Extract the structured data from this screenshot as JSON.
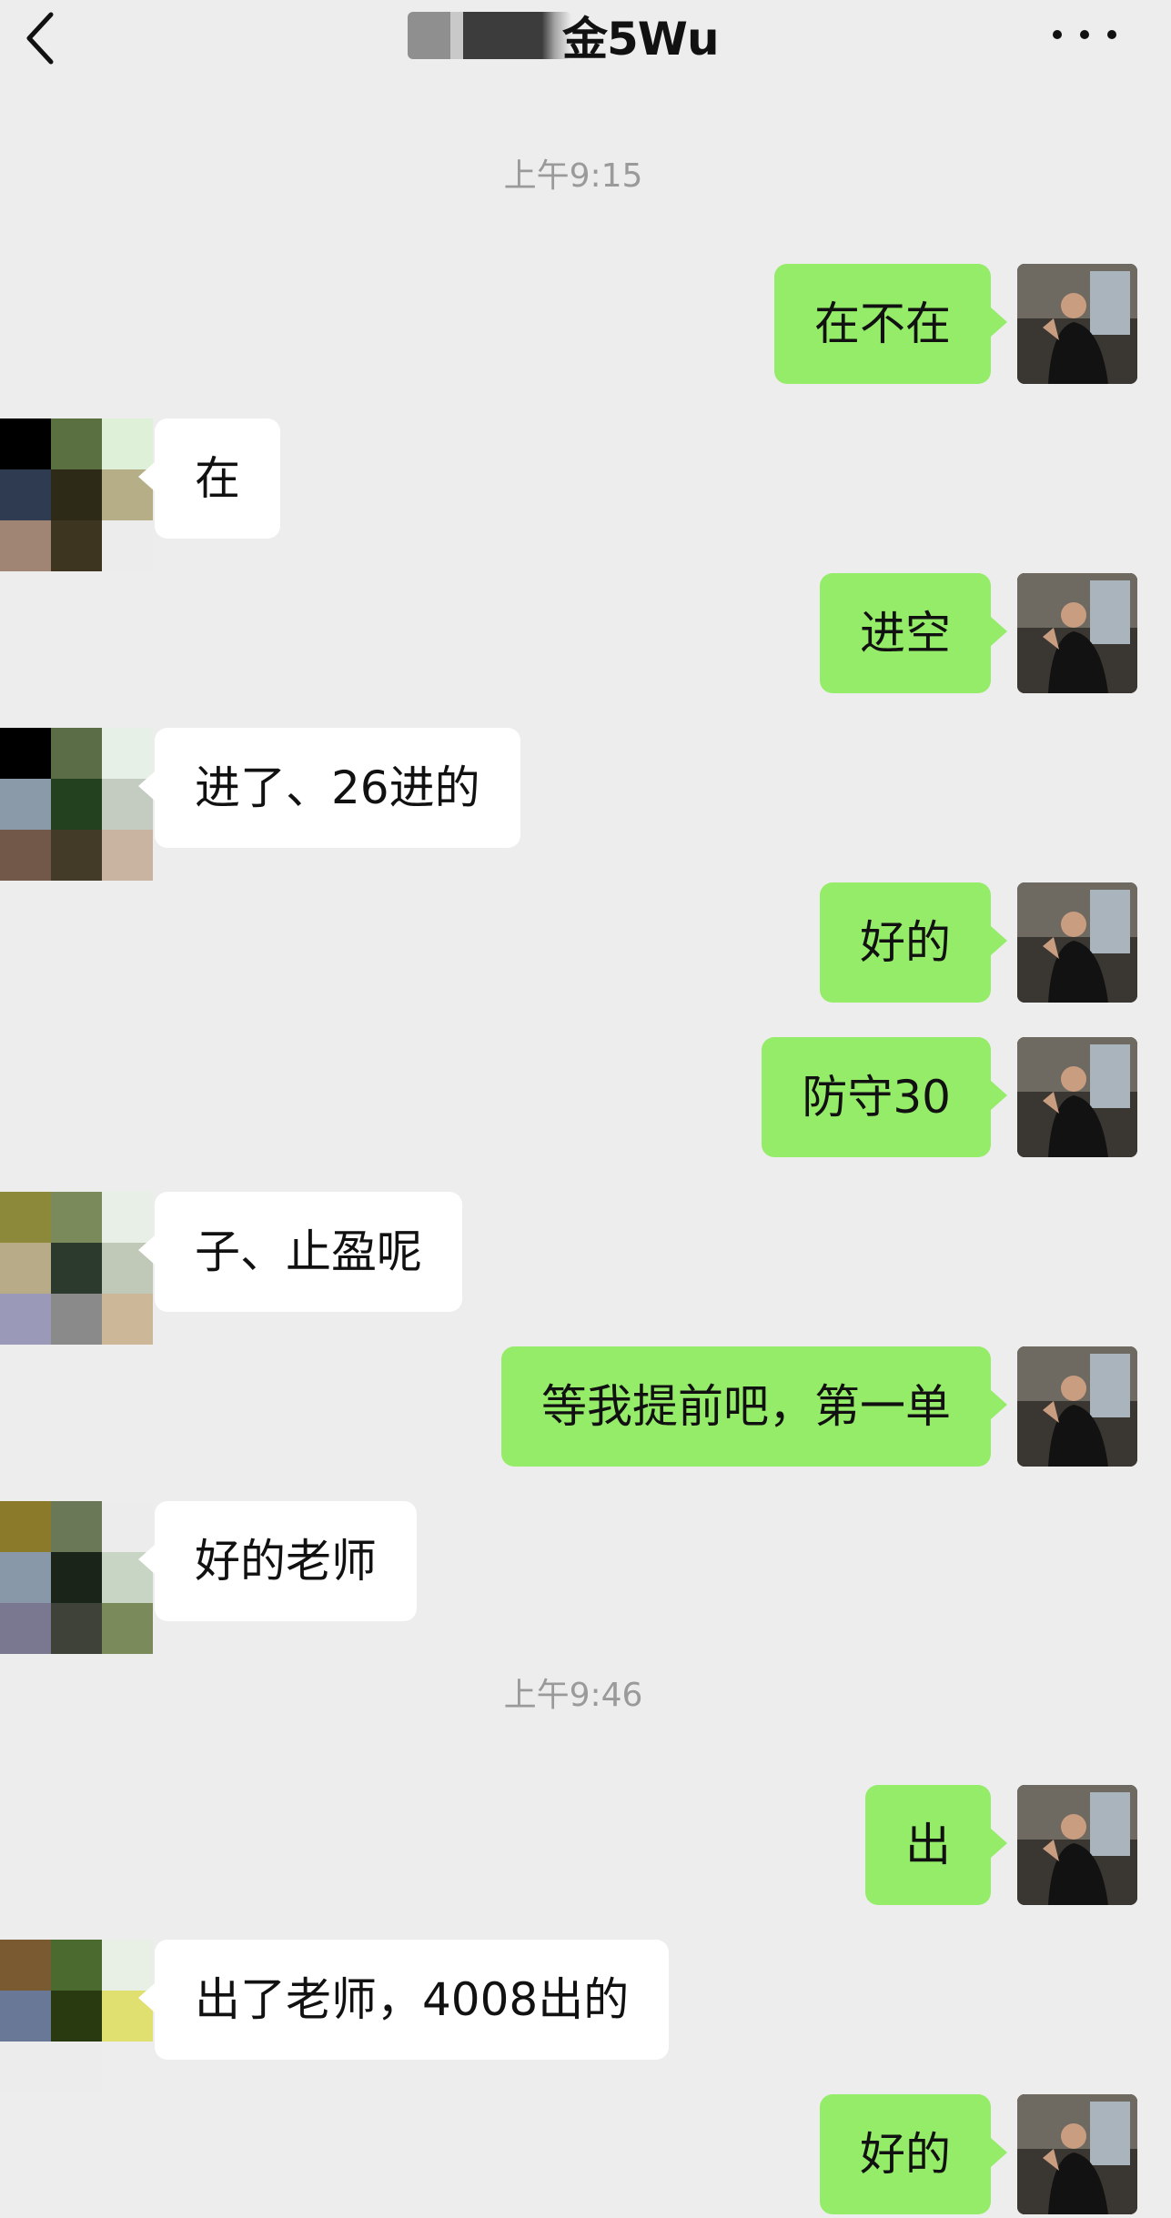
{
  "header": {
    "title": "金5Wu"
  },
  "messages": [
    {
      "type": "time",
      "text": "上午9:15"
    },
    {
      "type": "out",
      "text": "在不在"
    },
    {
      "type": "in",
      "text": "在"
    },
    {
      "type": "out",
      "text": "进空"
    },
    {
      "type": "in",
      "text": "进了、26进的"
    },
    {
      "type": "out",
      "text": "好的"
    },
    {
      "type": "out",
      "text": "防守30"
    },
    {
      "type": "in",
      "text": "子、止盈呢"
    },
    {
      "type": "out",
      "text": "等我提前吧，第一单"
    },
    {
      "type": "in",
      "text": "好的老师"
    },
    {
      "type": "time",
      "text": "上午9:46"
    },
    {
      "type": "out",
      "text": "出"
    },
    {
      "type": "in",
      "text": "出了老师，4008出的"
    },
    {
      "type": "out",
      "text": "好的"
    }
  ],
  "colors": {
    "background": "#ededed",
    "outgoing_bubble": "#95ec69",
    "incoming_bubble": "#ffffff",
    "timestamp": "#9a9a9a"
  },
  "icons": {
    "back": "chevron-left-icon",
    "more": "more-dots-icon"
  }
}
